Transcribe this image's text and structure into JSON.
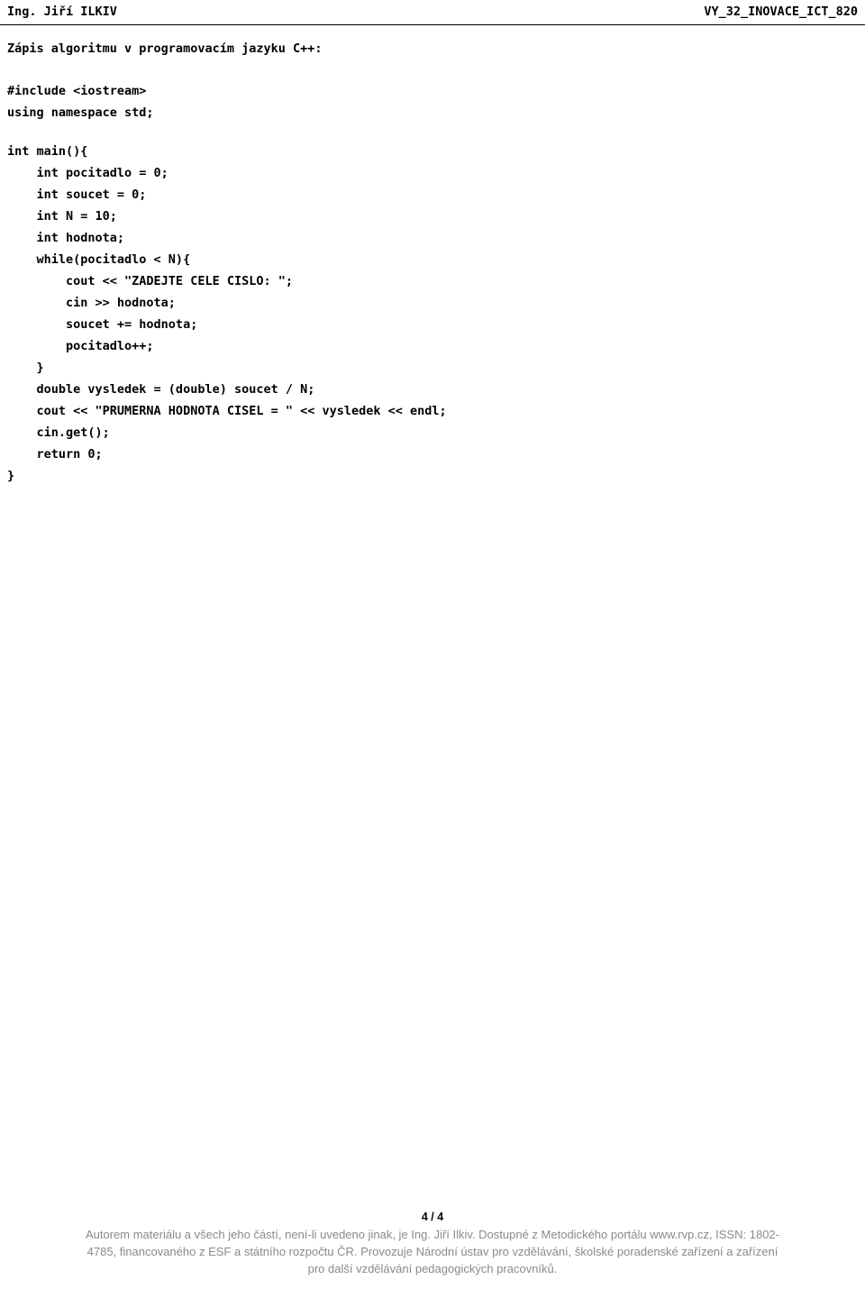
{
  "header": {
    "author": "Ing. Jiří ILKIV",
    "code": "VY_32_INOVACE_ICT_820"
  },
  "body": {
    "intro": "Zápis algoritmu v programovacím jazyku C++:",
    "code_block_1": "#include <iostream>\nusing namespace std;",
    "code_block_2": "int main(){\n    int pocitadlo = 0;\n    int soucet = 0;\n    int N = 10;\n    int hodnota;\n    while(pocitadlo < N){\n        cout << \"ZADEJTE CELE CISLO: \";\n        cin >> hodnota;\n        soucet += hodnota;\n        pocitadlo++;\n    }\n    double vysledek = (double) soucet / N;\n    cout << \"PRUMERNA HODNOTA CISEL = \" << vysledek << endl;\n    cin.get();\n    return 0;\n}"
  },
  "footer": {
    "page_number": "4 / 4",
    "note_line_1": "Autorem materiálu a všech jeho částí, není-li uvedeno jinak, je Ing. Jiří Ilkiv. Dostupné z Metodického portálu www.rvp.cz, ISSN: 1802-",
    "note_line_2": "4785, financovaného z ESF a státního rozpočtu ČR. Provozuje Národní ústav pro vzdělávání, školské poradenské zařízení a zařízení",
    "note_line_3": "pro další vzdělávání pedagogických pracovníků."
  },
  "colors": {
    "text": "#000000",
    "footer_text": "#8a8a8a",
    "background": "#ffffff"
  }
}
